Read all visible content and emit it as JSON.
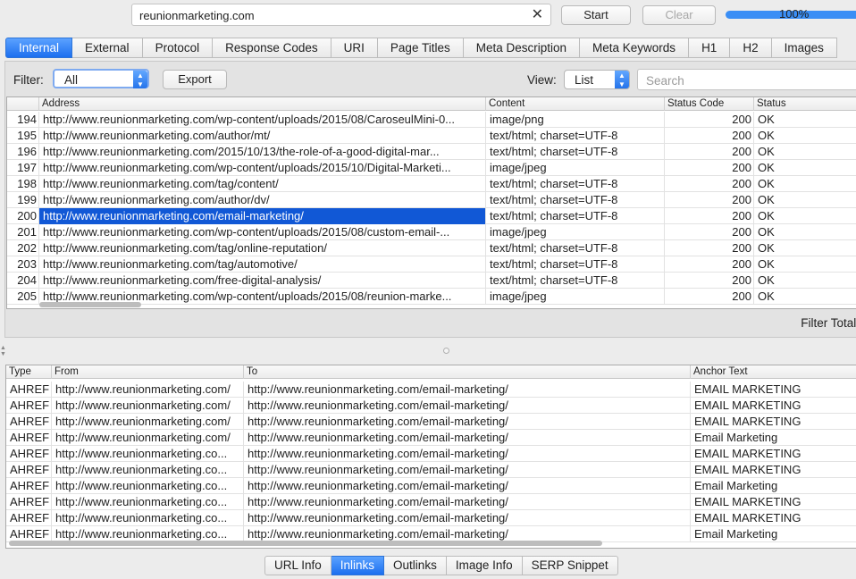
{
  "toolbar": {
    "url_value": "reunionmarketing.com",
    "clear_x": "✕",
    "start_label": "Start",
    "clear_label": "Clear",
    "progress_text": "100%",
    "progress_value": 100
  },
  "tabs": [
    "Internal",
    "External",
    "Protocol",
    "Response Codes",
    "URI",
    "Page Titles",
    "Meta Description",
    "Meta Keywords",
    "H1",
    "H2",
    "Images"
  ],
  "active_tab": "Internal",
  "upper": {
    "filter_label": "Filter:",
    "filter_value": "All",
    "export_label": "Export",
    "view_label": "View:",
    "view_value": "List",
    "search_placeholder": "Search",
    "filter_total_label": "Filter Total:",
    "columns": [
      "Address",
      "Content",
      "Status Code",
      "Status"
    ],
    "rows": [
      {
        "n": "194",
        "address": "http://www.reunionmarketing.com/wp-content/uploads/2015/08/CaroseulMini-0...",
        "content": "image/png",
        "code": "200",
        "status": "OK"
      },
      {
        "n": "195",
        "address": "http://www.reunionmarketing.com/author/mt/",
        "content": "text/html; charset=UTF-8",
        "code": "200",
        "status": "OK"
      },
      {
        "n": "196",
        "address": "http://www.reunionmarketing.com/2015/10/13/the-role-of-a-good-digital-mar...",
        "content": "text/html; charset=UTF-8",
        "code": "200",
        "status": "OK"
      },
      {
        "n": "197",
        "address": "http://www.reunionmarketing.com/wp-content/uploads/2015/10/Digital-Marketi...",
        "content": "image/jpeg",
        "code": "200",
        "status": "OK"
      },
      {
        "n": "198",
        "address": "http://www.reunionmarketing.com/tag/content/",
        "content": "text/html; charset=UTF-8",
        "code": "200",
        "status": "OK"
      },
      {
        "n": "199",
        "address": "http://www.reunionmarketing.com/author/dv/",
        "content": "text/html; charset=UTF-8",
        "code": "200",
        "status": "OK"
      },
      {
        "n": "200",
        "address": "http://www.reunionmarketing.com/email-marketing/",
        "content": "text/html; charset=UTF-8",
        "code": "200",
        "status": "OK",
        "selected": true
      },
      {
        "n": "201",
        "address": "http://www.reunionmarketing.com/wp-content/uploads/2015/08/custom-email-...",
        "content": "image/jpeg",
        "code": "200",
        "status": "OK"
      },
      {
        "n": "202",
        "address": "http://www.reunionmarketing.com/tag/online-reputation/",
        "content": "text/html; charset=UTF-8",
        "code": "200",
        "status": "OK"
      },
      {
        "n": "203",
        "address": "http://www.reunionmarketing.com/tag/automotive/",
        "content": "text/html; charset=UTF-8",
        "code": "200",
        "status": "OK"
      },
      {
        "n": "204",
        "address": "http://www.reunionmarketing.com/free-digital-analysis/",
        "content": "text/html; charset=UTF-8",
        "code": "200",
        "status": "OK"
      },
      {
        "n": "205",
        "address": "http://www.reunionmarketing.com/wp-content/uploads/2015/08/reunion-marke...",
        "content": "image/jpeg",
        "code": "200",
        "status": "OK"
      }
    ]
  },
  "lower": {
    "columns": [
      "Type",
      "From",
      "To",
      "Anchor Text"
    ],
    "rows": [
      {
        "type": "AHREF",
        "from": "http://www.reunionmarketing.com/",
        "to": "http://www.reunionmarketing.com/email-marketing/",
        "anchor": "EMAIL MARKETING"
      },
      {
        "type": "AHREF",
        "from": "http://www.reunionmarketing.com/",
        "to": "http://www.reunionmarketing.com/email-marketing/",
        "anchor": "EMAIL MARKETING"
      },
      {
        "type": "AHREF",
        "from": "http://www.reunionmarketing.com/",
        "to": "http://www.reunionmarketing.com/email-marketing/",
        "anchor": "EMAIL MARKETING"
      },
      {
        "type": "AHREF",
        "from": "http://www.reunionmarketing.com/",
        "to": "http://www.reunionmarketing.com/email-marketing/",
        "anchor": "Email Marketing"
      },
      {
        "type": "AHREF",
        "from": "http://www.reunionmarketing.co...",
        "to": "http://www.reunionmarketing.com/email-marketing/",
        "anchor": "EMAIL MARKETING"
      },
      {
        "type": "AHREF",
        "from": "http://www.reunionmarketing.co...",
        "to": "http://www.reunionmarketing.com/email-marketing/",
        "anchor": "EMAIL MARKETING"
      },
      {
        "type": "AHREF",
        "from": "http://www.reunionmarketing.co...",
        "to": "http://www.reunionmarketing.com/email-marketing/",
        "anchor": "Email Marketing"
      },
      {
        "type": "AHREF",
        "from": "http://www.reunionmarketing.co...",
        "to": "http://www.reunionmarketing.com/email-marketing/",
        "anchor": "EMAIL MARKETING"
      },
      {
        "type": "AHREF",
        "from": "http://www.reunionmarketing.co...",
        "to": "http://www.reunionmarketing.com/email-marketing/",
        "anchor": "EMAIL MARKETING"
      },
      {
        "type": "AHREF",
        "from": "http://www.reunionmarketing.co...",
        "to": "http://www.reunionmarketing.com/email-marketing/",
        "anchor": "Email Marketing"
      }
    ]
  },
  "bottom_tabs": [
    "URL Info",
    "Inlinks",
    "Outlinks",
    "Image Info",
    "SERP Snippet"
  ],
  "active_bottom_tab": "Inlinks"
}
